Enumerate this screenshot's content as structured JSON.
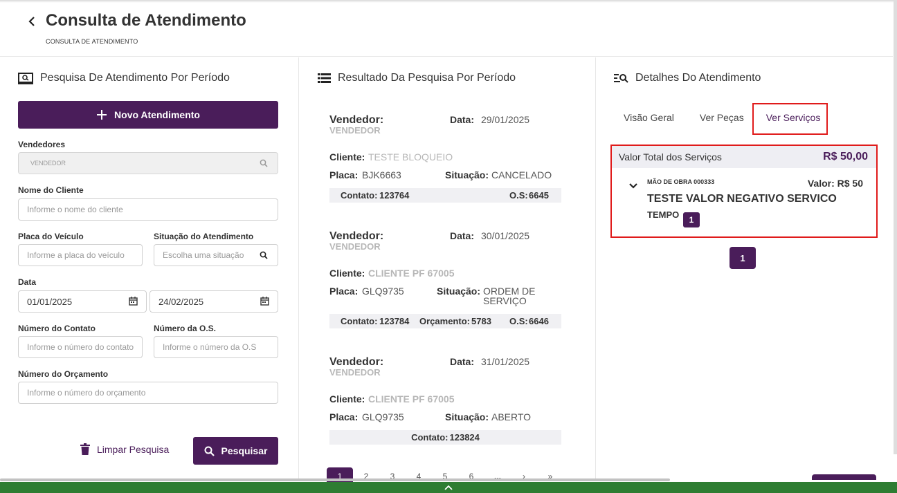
{
  "header": {
    "title": "Consulta de Atendimento",
    "subtitle": "CONSULTA DE ATENDIMENTO"
  },
  "left": {
    "title": "Pesquisa De Atendimento Por Período",
    "new_button": "Novo Atendimento",
    "vendedores_label": "Vendedores",
    "vendedores_value": "VENDEDOR",
    "cliente_label": "Nome do Cliente",
    "cliente_placeholder": "Informe o nome do cliente",
    "placa_label": "Placa do Veículo",
    "placa_placeholder": "Informe a placa do veículo",
    "situacao_label": "Situação do Atendimento",
    "situacao_placeholder": "Escolha uma situação",
    "data_label": "Data",
    "data_inicio": "01/01/2025",
    "data_fim": "24/02/2025",
    "contato_label": "Número do Contato",
    "contato_placeholder": "Informe o número do contato",
    "os_label": "Número da O.S.",
    "os_placeholder": "Informe o número da O.S",
    "orcamento_label": "Número do Orçamento",
    "orcamento_placeholder": "Informe o número do orçamento",
    "clear_button": "Limpar Pesquisa",
    "search_button": "Pesquisar"
  },
  "mid": {
    "title": "Resultado Da Pesquisa Por Período",
    "labels": {
      "vendedor": "Vendedor:",
      "data": "Data:",
      "cliente": "Cliente:",
      "placa": "Placa:",
      "situacao": "Situação:",
      "contato": "Contato:",
      "orcamento": "Orçamento:",
      "os": "O.S:"
    },
    "results": [
      {
        "vendedor": "VENDEDOR",
        "data": "29/01/2025",
        "cliente": "TESTE BLOQUEIO",
        "placa": "BJK6663",
        "situacao": "CANCELADO",
        "contato": "123764",
        "os": "6645"
      },
      {
        "vendedor": "VENDEDOR",
        "data": "30/01/2025",
        "cliente": "CLIENTE PF 67005",
        "placa": "GLQ9735",
        "situacao_l1": "ORDEM DE",
        "situacao_l2": "SERVIÇO",
        "contato": "123784",
        "orcamento": "5783",
        "os": "6646"
      },
      {
        "vendedor": "VENDEDOR",
        "data": "31/01/2025",
        "cliente": "CLIENTE PF 67005",
        "placa": "GLQ9735",
        "situacao": "ABERTO",
        "contato": "123824"
      }
    ],
    "pages": [
      "1",
      "2",
      "3",
      "4",
      "5",
      "6",
      "...",
      "›",
      "»"
    ]
  },
  "right": {
    "title": "Detalhes Do Atendimento",
    "tabs": [
      "Visão Geral",
      "Ver Peças",
      "Ver Serviços"
    ],
    "total_label": "Valor Total dos Serviços",
    "total_value": "R$ 50,00",
    "service": {
      "code": "MÃO DE OBRA 000333",
      "price": "Valor: R$ 50",
      "name": "TESTE VALOR NEGATIVO SERVICO",
      "time_label": "TEMPO",
      "time_value": "1"
    },
    "page": "1"
  },
  "colors": {
    "primary": "#4a1d5a",
    "highlight": "#e01b1b",
    "bottom_bar": "#2e7d32"
  }
}
